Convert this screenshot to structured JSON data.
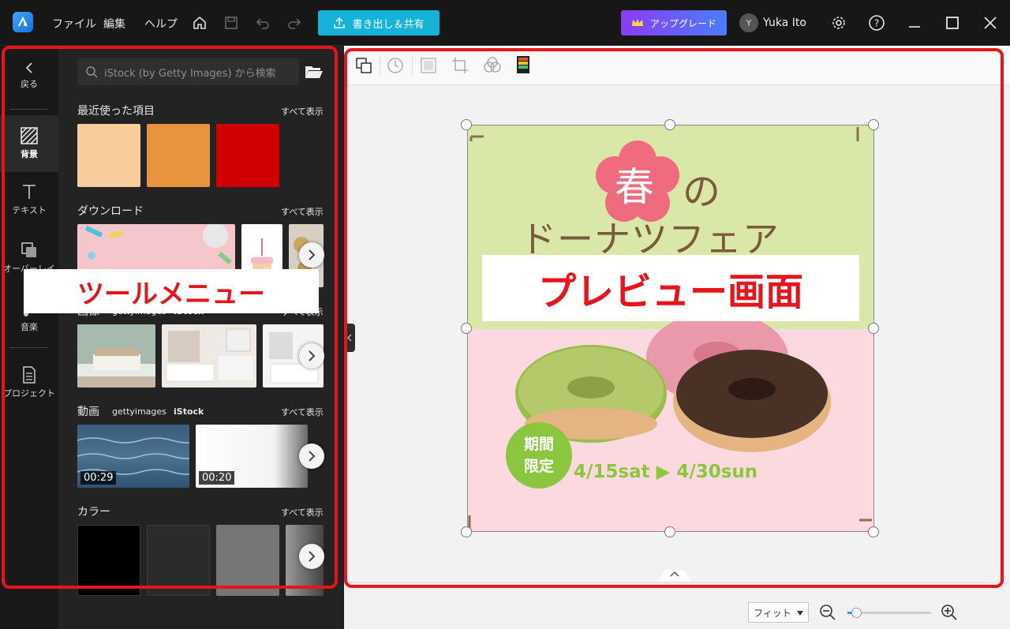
{
  "topbar": {
    "menus": [
      "ファイル",
      "編集",
      "ヘルプ"
    ],
    "export_label": "書き出し＆共有",
    "upgrade_label": "アップグレード",
    "avatar_initial": "Y",
    "username": "Yuka Ito"
  },
  "rail": {
    "back_label": "戻る",
    "items": [
      {
        "label": "背景",
        "icon": "background-icon",
        "active": true
      },
      {
        "label": "テキスト",
        "icon": "text-icon"
      },
      {
        "label": "オーバーレイ",
        "icon": "overlay-icon"
      },
      {
        "label": "音楽",
        "icon": "music-icon"
      },
      {
        "label": "プロジェクト",
        "icon": "project-icon"
      }
    ]
  },
  "panel": {
    "search_placeholder": "iStock (by Getty Images) から検索",
    "see_all": "すべて表示",
    "recent": {
      "title": "最近使った項目",
      "colors": [
        "#f9cc9c",
        "#e8943f",
        "#d10000"
      ]
    },
    "downloads": {
      "title": "ダウンロード"
    },
    "images": {
      "title": "画像",
      "provider_getty": "gettyimages",
      "provider_istock": "iStock"
    },
    "videos": {
      "title": "動画",
      "provider_getty": "gettyimages",
      "provider_istock": "iStock",
      "durations": [
        "00:29",
        "00:20"
      ]
    },
    "colors": {
      "title": "カラー",
      "swatches": [
        "#000000",
        "#2b2b2b",
        "#767676"
      ]
    }
  },
  "canvas": {
    "spring_char": "春",
    "no_char": "の",
    "headline": "ドーナツフェア",
    "badge_line1": "期間",
    "badge_line2": "限定",
    "dates": "4/15sat ▶ 4/30sun",
    "colors": {
      "top_bg": "#d9e8a8",
      "bottom_bg": "#fcd9df",
      "flower": "#ee6c7d",
      "badge": "#8cc63e",
      "date_text": "#8cc63e"
    }
  },
  "bottombar": {
    "zoom_mode": "フィット",
    "zoom_level": 0.1
  },
  "annotations": {
    "tool_menu_label": "ツールメニュー",
    "preview_label": "プレビュー画面",
    "color": "#e8141c"
  }
}
